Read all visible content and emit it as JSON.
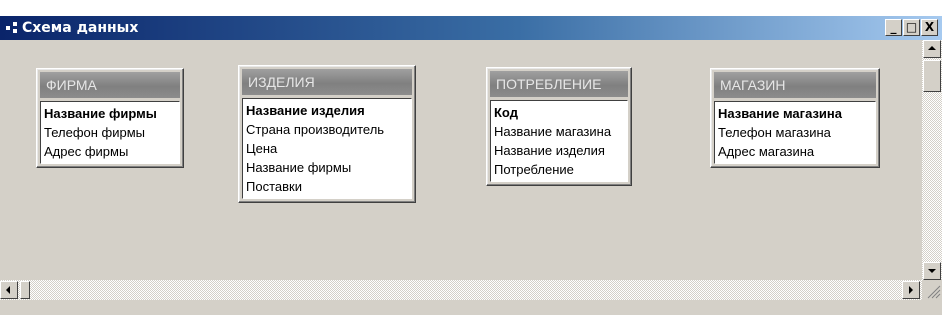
{
  "window": {
    "title": "Схема данных",
    "buttons": {
      "minimize": "_",
      "maximize": "□",
      "close": "X"
    }
  },
  "tables": [
    {
      "name": "ФИРМА",
      "fields": [
        "Название фирмы",
        "Телефон фирмы",
        "Адрес фирмы"
      ],
      "key_index": 0,
      "selected_index": 0
    },
    {
      "name": "ИЗДЕЛИЯ",
      "fields": [
        "Название изделия",
        "Страна производитель",
        "Цена",
        "Название фирмы",
        "Поставки"
      ],
      "key_index": 0
    },
    {
      "name": "ПОТРЕБЛЕНИЕ",
      "fields": [
        "Код",
        "Название магазина",
        "Название изделия",
        "Потребление"
      ],
      "key_index": 0
    },
    {
      "name": "МАГАЗИН",
      "fields": [
        "Название магазина",
        "Телефон магазина",
        "Адрес магазина"
      ],
      "key_index": 0
    }
  ],
  "colors": {
    "title_bar_start": "#0a246a",
    "title_bar_end": "#a6caf0",
    "client_background": "#d4d0c8",
    "selection": "#0a246a"
  }
}
